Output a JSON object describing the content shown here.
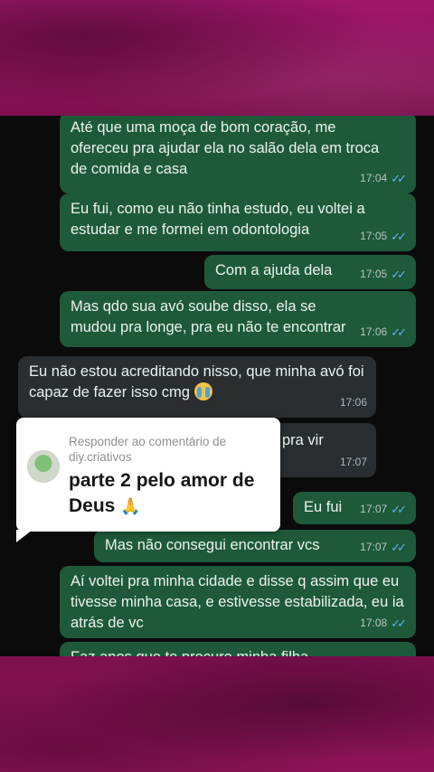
{
  "messages": [
    {
      "id": "m1",
      "side": "out",
      "text": "Até que uma moça de bom coração, me ofereceu pra ajudar ela no salão dela em troca de comida e casa",
      "time": "17:04"
    },
    {
      "id": "m2",
      "side": "out",
      "text": "Eu fui, como eu não tinha estudo, eu voltei a estudar e me formei em odontologia",
      "time": "17:05"
    },
    {
      "id": "m3",
      "side": "out",
      "text": "Com a ajuda dela",
      "time": "17:05"
    },
    {
      "id": "m4",
      "side": "out",
      "text": "Mas qdo sua avó soube disso, ela se mudou pra longe, pra eu não te encontrar",
      "time": "17:06"
    },
    {
      "id": "m5",
      "side": "in",
      "text": "Eu não estou acreditando nisso, que minha avó foi capaz de fazer isso cmg",
      "time": "17:06"
    },
    {
      "id": "m6",
      "side": "in",
      "text": "pra vir",
      "time": "17:07"
    },
    {
      "id": "m7",
      "side": "out",
      "text": "Eu fui",
      "time": "17:07"
    },
    {
      "id": "m8",
      "side": "out",
      "text": "Mas não consegui encontrar vcs",
      "time": "17:07"
    },
    {
      "id": "m9",
      "side": "out",
      "text": "Aí voltei pra minha cidade e disse q assim que eu tivesse minha casa, e estivesse estabilizada, eu ia atrás de vc",
      "time": "17:08"
    },
    {
      "id": "m10",
      "side": "out",
      "text": "Faz anos que te procuro minha filha",
      "time": ""
    }
  ],
  "comment": {
    "reply_label": "Responder ao comentário de diy.criativos",
    "text": "parte 2 pelo amor de Deus",
    "emoji": "🙏"
  },
  "colors": {
    "outgoing": "#1e5a3a",
    "incoming": "#2a2e31",
    "read_ticks": "#5cb4f0",
    "background": "#8a1357"
  },
  "icons": {
    "read": "double-check-icon",
    "crying": "crying-face-icon",
    "avatar": "user-avatar"
  }
}
